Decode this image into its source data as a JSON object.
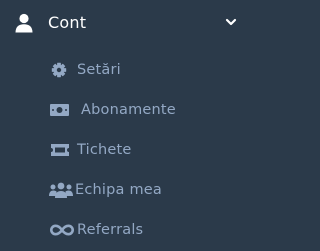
{
  "menu": {
    "header": {
      "label": "Cont",
      "icon": "user-icon",
      "toggle_icon": "chevron-down-icon",
      "expanded": true
    },
    "items": [
      {
        "label": "Setări",
        "icon": "gear-icon"
      },
      {
        "label": "Abonamente",
        "icon": "money-bill-icon"
      },
      {
        "label": "Tichete",
        "icon": "ticket-icon"
      },
      {
        "label": "Echipa mea",
        "icon": "users-icon"
      },
      {
        "label": "Referrals",
        "icon": "infinity-icon"
      }
    ]
  },
  "colors": {
    "background": "#2b3a4a",
    "header_text": "#ffffff",
    "item_text": "#93a8c4",
    "item_icon": "#93a8c4"
  }
}
